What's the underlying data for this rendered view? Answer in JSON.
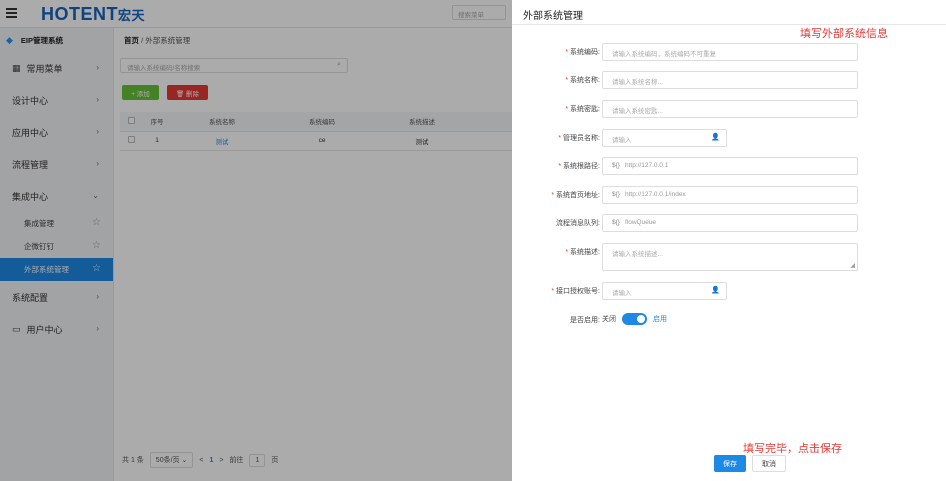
{
  "app": {
    "logo": "OTENT",
    "logo_suffix": "宏天",
    "top_search_placeholder": "搜索菜单",
    "system_name": "EIP管理系统"
  },
  "sidebar": {
    "items": [
      {
        "label": "常用菜单",
        "icon": "grid-icon"
      },
      {
        "label": "设计中心"
      },
      {
        "label": "应用中心"
      },
      {
        "label": "流程管理"
      },
      {
        "label": "集成中心",
        "expanded": true
      },
      {
        "label": "系统配置"
      },
      {
        "label": "用户中心",
        "icon": "monitor-icon"
      }
    ],
    "sub_items": [
      {
        "label": "集成管理"
      },
      {
        "label": "企微钉钉"
      },
      {
        "label": "外部系统管理",
        "active": true
      }
    ]
  },
  "main": {
    "breadcrumb_home": "首页",
    "breadcrumb_sep": "/",
    "breadcrumb_current": "外部系统管理",
    "filter_placeholder": "请输入系统编码/名称搜索",
    "add_label": "+ 添加",
    "delete_label": "🗑 删除",
    "table": {
      "headers": [
        "序号",
        "系统名称",
        "系统编码",
        "系统描述"
      ],
      "rows": [
        {
          "index": "1",
          "name": "测试",
          "code": "ce",
          "desc": "测试"
        }
      ]
    },
    "pager": {
      "total": "共 1 条",
      "page_size": "50条/页",
      "prev": "<",
      "current": "1",
      "next": ">",
      "goto_label": "前往",
      "goto_value": "1",
      "page_suffix": "页"
    }
  },
  "drawer": {
    "title": "外部系统管理",
    "annotation_top": "填写外部系统信息",
    "annotation_bottom": "填写完毕，点击保存",
    "fields": {
      "code": {
        "label": "系统编码:",
        "placeholder": "请输入系统编码，系统编码不可重复"
      },
      "name": {
        "label": "系统名称:",
        "placeholder": "请输入系统名称..."
      },
      "secret": {
        "label": "系统密匙:",
        "placeholder": "请输入系统密匙..."
      },
      "admin": {
        "label": "管理员名称:",
        "placeholder": "请输入"
      },
      "root_path": {
        "label": "系统根路径:",
        "prefix": "${}",
        "value": "http://127.0.0.1"
      },
      "home_url": {
        "label": "系统首页地址:",
        "prefix": "${}",
        "value": "http://127.0.0.1/index"
      },
      "queue": {
        "label": "流程消息队列:",
        "prefix": "${}",
        "value": "flowQueue"
      },
      "desc": {
        "label": "系统描述:",
        "placeholder": "请输入系统描述..."
      },
      "auth": {
        "label": "接口授权账号:",
        "placeholder": "请输入"
      },
      "enabled": {
        "label": "是否启用:",
        "off_text": "关闭",
        "on_text": "启用",
        "value": true
      }
    },
    "save_label": "保存",
    "cancel_label": "取消"
  }
}
